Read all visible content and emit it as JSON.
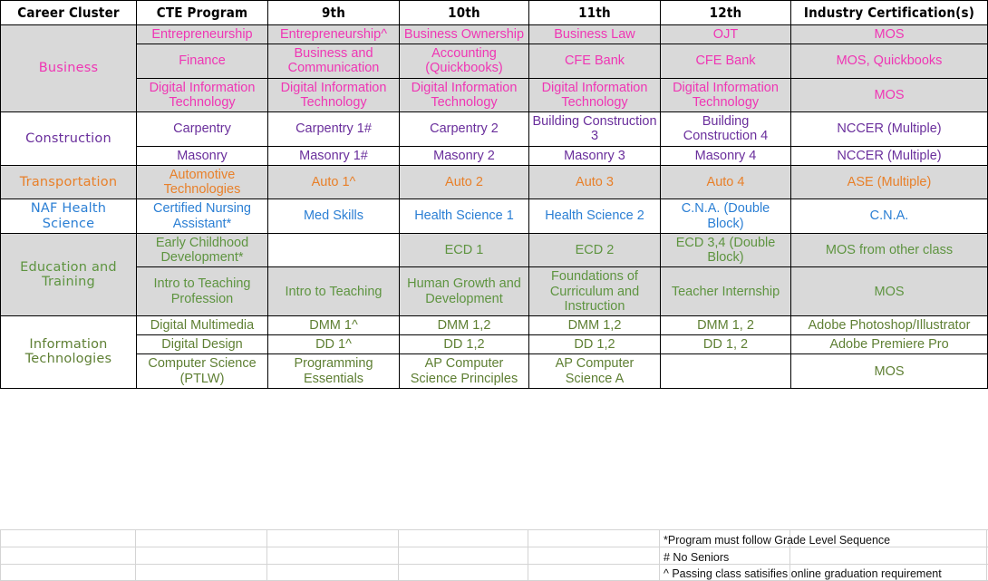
{
  "table": {
    "headers": [
      "Career Cluster",
      "CTE Program",
      "9th",
      "10th",
      "11th",
      "12th",
      "Industry Certification(s)"
    ],
    "clusters": [
      {
        "name": "Business",
        "color": "#ef36b4",
        "shaded": true,
        "rows": [
          {
            "program": "Entrepreneurship",
            "g9": "Entrepreneurship^",
            "g10": "Business Ownership",
            "g11": "Business Law",
            "g12": "OJT",
            "cert": "MOS"
          },
          {
            "program": "Finance",
            "g9": "Business and Communication",
            "g10": "Accounting (Quickbooks)",
            "g11": "CFE Bank",
            "g12": "CFE Bank",
            "cert": "MOS, Quickbooks"
          },
          {
            "program": "Digital Information Technology",
            "g9": "Digital Information Technology",
            "g10": "Digital Information Technology",
            "g11": "Digital Information Technology",
            "g12": "Digital Information Technology",
            "cert": "MOS"
          }
        ]
      },
      {
        "name": "Construction",
        "color": "#6a2f9c",
        "shaded": false,
        "rows": [
          {
            "program": "Carpentry",
            "g9": "Carpentry 1#",
            "g10": "Carpentry 2",
            "g11": "Building Construction 3",
            "g12": "Building Construction 4",
            "cert": "NCCER (Multiple)"
          },
          {
            "program": "Masonry",
            "g9": "Masonry 1#",
            "g10": "Masonry 2",
            "g11": "Masonry 3",
            "g12": "Masonry 4",
            "cert": "NCCER (Multiple)"
          }
        ]
      },
      {
        "name": "Transportation",
        "color": "#e8802a",
        "shaded": true,
        "rows": [
          {
            "program": "Automotive Technologies",
            "g9": "Auto 1^",
            "g10": "Auto 2",
            "g11": "Auto 3",
            "g12": "Auto 4",
            "cert": "ASE (Multiple)"
          }
        ]
      },
      {
        "name": "NAF Health Science",
        "color": "#2b7fd4",
        "shaded": false,
        "rows": [
          {
            "program": "Certified Nursing Assistant*",
            "g9": "Med Skills",
            "g10": "Health Science 1",
            "g11": "Health Science 2",
            "g12": "C.N.A. (Double Block)",
            "cert": "C.N.A."
          }
        ]
      },
      {
        "name": "Education and Training",
        "color": "#5e9440",
        "shaded": true,
        "rows": [
          {
            "program": "Early Childhood Development*",
            "g9": "",
            "g9_blank": true,
            "g10": "ECD 1",
            "g11": "ECD 2",
            "g12": "ECD 3,4 (Double Block)",
            "cert": "MOS from other class"
          },
          {
            "program": "Intro to Teaching Profession",
            "g9": "Intro to Teaching",
            "g10": "Human Growth and Development",
            "g11": "Foundations of Curriculum and Instruction",
            "g12": "Teacher Internship",
            "cert": "MOS"
          }
        ]
      },
      {
        "name": "Information Technologies",
        "color": "#5e7f33",
        "shaded": false,
        "rows": [
          {
            "program": "Digital Multimedia",
            "g9": "DMM 1^",
            "g10": "DMM 1,2",
            "g11": "DMM 1,2",
            "g12": "DMM 1, 2",
            "cert": "Adobe Photoshop/Illustrator"
          },
          {
            "program": "Digital Design",
            "g9": "DD 1^",
            "g10": "DD 1,2",
            "g11": "DD 1,2",
            "g12": "DD 1, 2",
            "cert": "Adobe Premiere Pro"
          },
          {
            "program": "Computer Science (PTLW)",
            "g9": "Programming Essentials",
            "g10": "AP Computer Science Principles",
            "g11": "AP Computer Science A",
            "g12": "",
            "cert": "MOS"
          }
        ]
      }
    ]
  },
  "legend": [
    "*Program must follow Grade Level Sequence",
    "# No Seniors",
    "^ Passing class satisifies online graduation requirement"
  ]
}
